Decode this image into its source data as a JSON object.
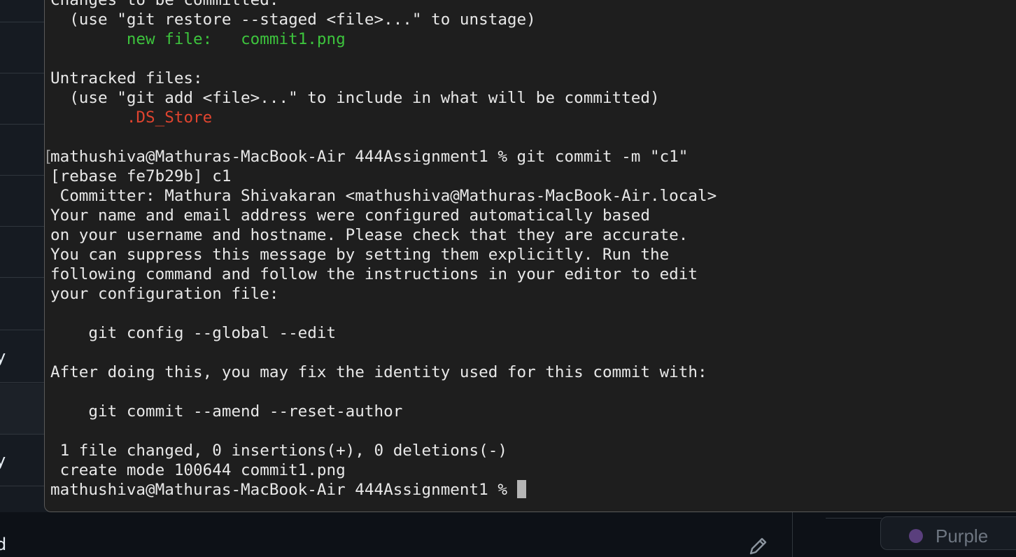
{
  "background_app": {
    "row_letters": [
      "y",
      "y"
    ],
    "bottom_letter": "d",
    "label_chip": {
      "name": "Purple",
      "dot_color": "#5a3f7d"
    },
    "edit_icon": "pencil-icon"
  },
  "terminal": {
    "lines": [
      {
        "text": "Changes to be committed:"
      },
      {
        "text": "  (use \"git restore --staged <file>...\" to unstage)"
      },
      {
        "prefix": "        ",
        "status": "new file:",
        "spacer": "   ",
        "file": "commit1.png",
        "color": "green"
      },
      {
        "text": ""
      },
      {
        "text": "Untracked files:"
      },
      {
        "text": "  (use \"git add <file>...\" to include in what will be committed)"
      },
      {
        "prefix": "        ",
        "file": ".DS_Store",
        "color": "red"
      },
      {
        "text": ""
      },
      {
        "text": "mathushiva@Mathuras-MacBook-Air 444Assignment1 % git commit -m \"c1\""
      },
      {
        "text": "[rebase fe7b29b] c1"
      },
      {
        "text": " Committer: Mathura Shivakaran <mathushiva@Mathuras-MacBook-Air.local>"
      },
      {
        "text": "Your name and email address were configured automatically based"
      },
      {
        "text": "on your username and hostname. Please check that they are accurate."
      },
      {
        "text": "You can suppress this message by setting them explicitly. Run the"
      },
      {
        "text": "following command and follow the instructions in your editor to edit"
      },
      {
        "text": "your configuration file:"
      },
      {
        "text": ""
      },
      {
        "text": "    git config --global --edit"
      },
      {
        "text": ""
      },
      {
        "text": "After doing this, you may fix the identity used for this commit with:"
      },
      {
        "text": ""
      },
      {
        "text": "    git commit --amend --reset-author"
      },
      {
        "text": ""
      },
      {
        "text": " 1 file changed, 0 insertions(+), 0 deletions(-)"
      },
      {
        "text": " create mode 100644 commit1.png"
      }
    ],
    "prompt": "mathushiva@Mathuras-MacBook-Air 444Assignment1 % ",
    "colors": {
      "background": "#1e1e1e",
      "text": "#e8e8e8",
      "green": "#3dc43d",
      "red": "#e0442f"
    }
  }
}
